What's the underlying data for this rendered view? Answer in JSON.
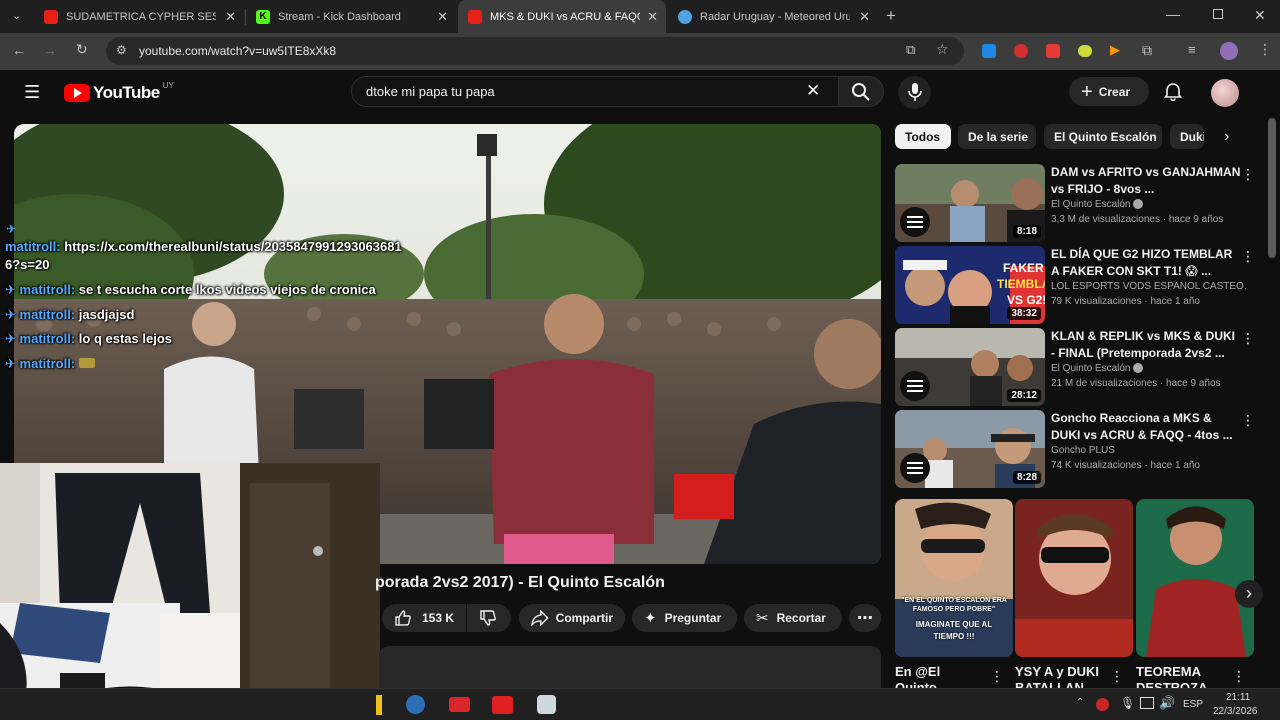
{
  "browser": {
    "tabs": [
      {
        "title": "SUDAMETRICA CYPHER SESSIO",
        "color": "#e62117"
      },
      {
        "title": "Stream - Kick Dashboard",
        "color": "#53fc18"
      },
      {
        "title": "MKS & DUKI vs ACRU & FAQQ",
        "color": "#e62117"
      },
      {
        "title": "Radar Uruguay - Meteored Uru",
        "color": "#4fa3e0"
      }
    ],
    "url": "youtube.com/watch?v=uw5ITE8xXk8"
  },
  "youtube": {
    "logo_text": "YouTube",
    "country": "UY",
    "search_value": "dtoke mi papa tu papa",
    "create_label": "Crear"
  },
  "chips": [
    "Todos",
    "De la serie",
    "El Quinto Escalón",
    "Duki"
  ],
  "video": {
    "title_visible": "porada 2vs2 2017) - El Quinto Escalón",
    "likes": "153 K",
    "share_label": "Compartir",
    "ask_label": "Preguntar",
    "clip_label": "Recortar"
  },
  "chat": [
    {
      "user": "",
      "text": "https://x.com/therealbuni/status/2035847991293063681"
    },
    {
      "user": "",
      "text": "6?s=20"
    },
    {
      "user": "matitroll:",
      "text": "se t escucha corte lkos videos viejos de cronica"
    },
    {
      "user": "matitroll:",
      "text": "jasdjajsd"
    },
    {
      "user": "matitroll:",
      "text": "lo q estas lejos"
    },
    {
      "user": "matitroll:",
      "text": ""
    }
  ],
  "chat_first_user": "matitroll:",
  "recommendations": [
    {
      "title": "DAM vs AFRITO vs GANJAHMAN vs FRIJO - 8vos ...",
      "channel": "El Quinto Escalón",
      "meta": "3,3 M de visualizaciones · hace 9 años",
      "duration": "8:18"
    },
    {
      "title": "EL DÍA QUE G2 HIZO TEMBLAR A FAKER CON SKT T1! 😱 ...",
      "channel": "LOL ESPORTS VODS ESPAÑOL CASTEO...",
      "meta": "79 K visualizaciones · hace 1 año",
      "duration": "38:32"
    },
    {
      "title": "KLAN & REPLIK vs MKS & DUKI - FINAL (Pretemporada 2vs2 ...",
      "channel": "El Quinto Escalón",
      "meta": "21 M de visualizaciones · hace 9 años",
      "duration": "28:12"
    },
    {
      "title": "Goncho Reacciona a MKS & DUKI vs ACRU & FAQQ - 4tos ...",
      "channel": "Goncho PLUS",
      "meta": "74 K visualizaciones · hace 1 año",
      "duration": "8:28"
    }
  ],
  "thumb_text": {
    "faker": "FAKER TIEMBLA VS G2!"
  },
  "shorts": [
    {
      "title": "En @El Quinto",
      "caption": "\"EN EL QUINTO ESCALÓN ERA FAMOSO PERO POBRE\"",
      "caption2": "IMAGINATE QUE AL TIEMPO !!!"
    },
    {
      "title": "YSY A y DUKI BATALLAN",
      "caption": "",
      "caption2": ""
    },
    {
      "title": "TEOREMA DESTROZA",
      "caption": "",
      "caption2": ""
    }
  ],
  "taskbar": {
    "lang": "ESP",
    "time": "21:11",
    "date": "22/3/2026"
  }
}
